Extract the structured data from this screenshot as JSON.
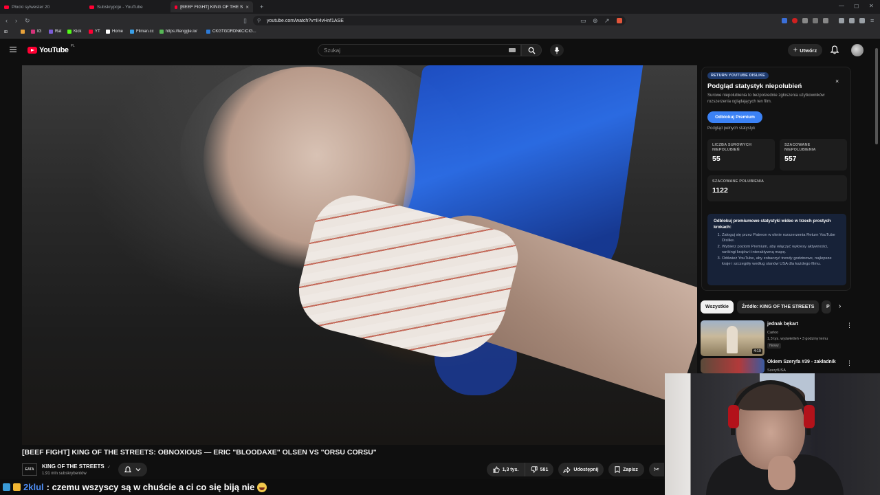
{
  "browser": {
    "tabs": [
      {
        "label": "Płocki sylwester 20"
      },
      {
        "label": "Subskrypcje - YouTube"
      },
      {
        "label": "[BEEF FIGHT] KING OF THE S"
      }
    ],
    "active_tab_close": "×",
    "new_tab": "+",
    "url": "youtube.com/watch?v=II4vHnf1ASE",
    "bookmarks": [
      "IG",
      "Rat",
      "Kick",
      "YT",
      "Home",
      "Filman.cc",
      "https://tenggle.io/",
      "CKGTGDRDN€CICIG..."
    ]
  },
  "youtube": {
    "logo_text": "YouTube",
    "region": "PL",
    "search_placeholder": "Szukaj",
    "create_label": "Utwórz"
  },
  "video": {
    "title": "[BEEF FIGHT] KING OF THE STREETS: OBNOXIOUS — ERIC \"BLOODAXE\" OLSEN VS \"ORSU CORSU\"",
    "channel_logo_text": "EATA",
    "channel_name": "KING OF THE STREETS",
    "verified_mark": "✓",
    "subscribers": "1,91 mln subskrybentów",
    "likes": "1,3 tys.",
    "dislikes": "581",
    "share_label": "Udostępnij",
    "save_label": "Zapisz"
  },
  "ryd": {
    "badge": "RETURN YOUTUBE DISLIKE",
    "close": "×",
    "title": "Podgląd statystyk niepolubień",
    "description": "Surowe niepolubienia to bezpośrednie zgłoszenia użytkowników rozszerzenia oglądających ten film.",
    "unlock_label": "Odblokuj Premium",
    "full_stats": "Podgląd pełnych statystyk",
    "raw_label": "LICZBA SUROWYCH NIEPOLUBIEŃ",
    "raw_value": "55",
    "est_dislikes_label": "SZACOWANE NIEPOLUBIENIA",
    "est_dislikes_value": "557",
    "est_likes_label": "SZACOWANE POLUBIENIA",
    "est_likes_value": "1122",
    "steps_title": "Odblokuj premiumowe statystyki wideo w trzech prostych krokach:",
    "steps": [
      "Zaloguj się przez Patreon w oknie rozszerzenia Return YouTube Dislike.",
      "Wybierz poziom Premium, aby włączyć wykresy aktywności, rankingi krajów i interaktywną mapę.",
      "Odśwież YouTube, aby zobaczyć trendy godzinowe, najlepsze kraje i szczegóły według stanów USA dla każdego filmu."
    ]
  },
  "chips": {
    "all": "Wszystkie",
    "source": "Źródło: KING OF THE STREETS",
    "more": "P"
  },
  "recommendations": [
    {
      "title": "jednak bękart",
      "channel": "Carloo",
      "meta": "1,3 tys. wyświetleń • 3 godziny temu",
      "badge": "Nowy",
      "duration": "4:19"
    },
    {
      "title": "Okiem Szeryfa #39 - zakładnik",
      "channel": "SzeryfUSA",
      "meta": "",
      "badge": "",
      "duration": ""
    }
  ],
  "chat": {
    "username": "2klul",
    "message": ": czemu wszyscy są w chuście a ci co się biją nie"
  },
  "colors": {
    "yt_red": "#ff0033",
    "ryd_blue": "#3b82f6",
    "chat_username": "#4f8ff7"
  }
}
